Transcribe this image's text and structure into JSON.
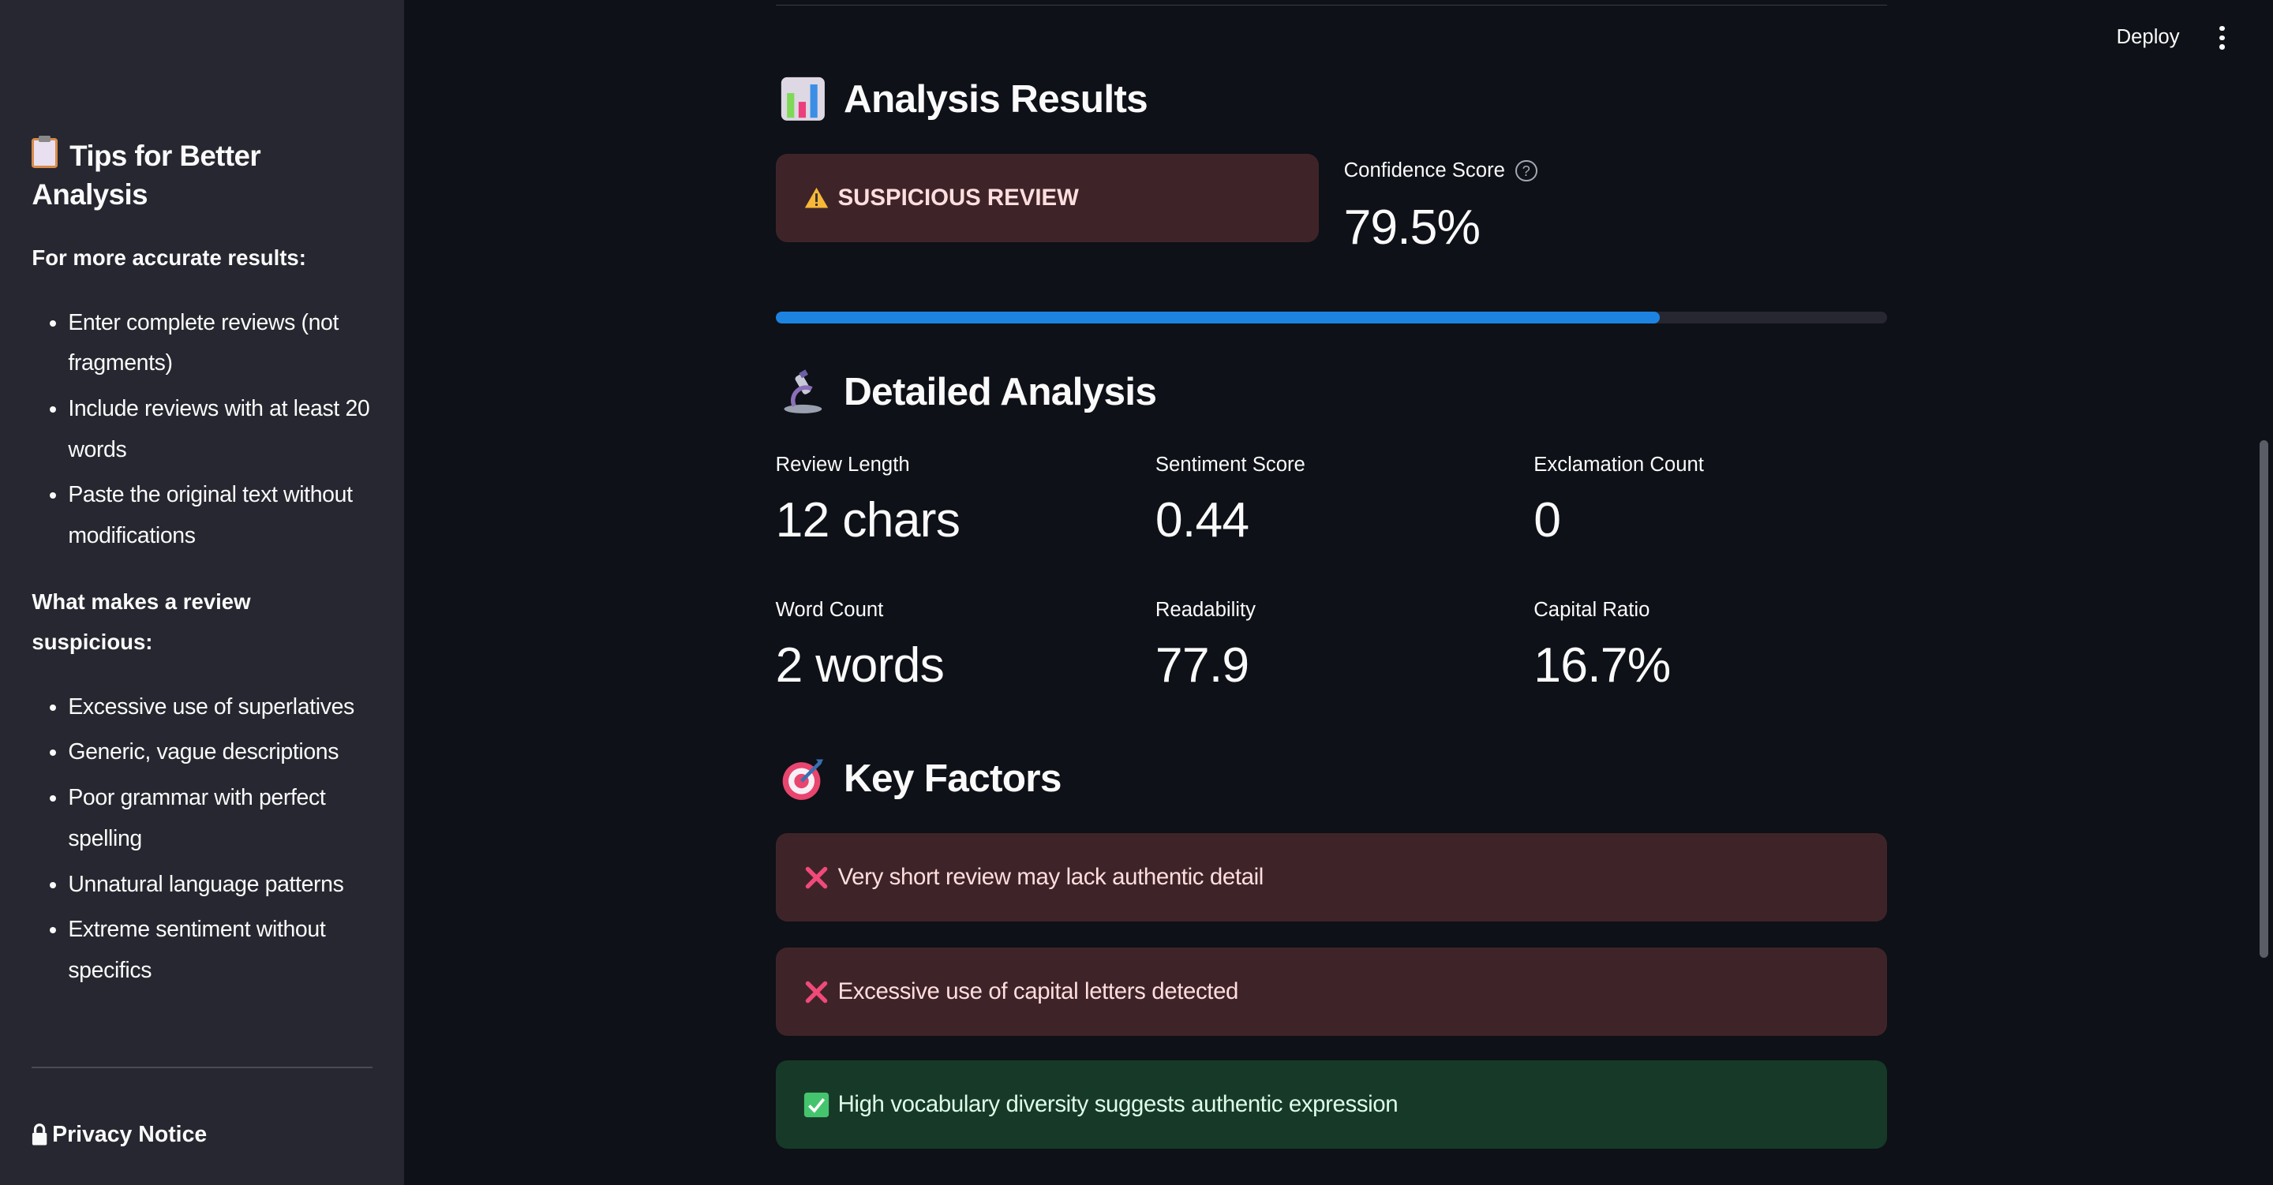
{
  "sidebar": {
    "title": "Tips for Better Analysis",
    "accurate_heading": "For more accurate results:",
    "accurate_tips": [
      "Enter complete reviews (not fragments)",
      "Include reviews with at least 20 words",
      "Paste the original text without modifications"
    ],
    "suspicious_heading": "What makes a review suspicious:",
    "suspicious_signs": [
      "Excessive use of superlatives",
      "Generic, vague descriptions",
      "Poor grammar with perfect spelling",
      "Unnatural language patterns",
      "Extreme sentiment without specifics"
    ],
    "privacy_label": "Privacy Notice"
  },
  "header": {
    "deploy_label": "Deploy"
  },
  "results": {
    "title": "Analysis Results",
    "verdict": "SUSPICIOUS REVIEW",
    "confidence_label": "Confidence Score",
    "confidence_value": "79.5%",
    "confidence_fraction": 0.795
  },
  "detailed": {
    "title": "Detailed Analysis",
    "metrics": [
      {
        "label": "Review Length",
        "value": "12 chars"
      },
      {
        "label": "Sentiment Score",
        "value": "0.44"
      },
      {
        "label": "Exclamation Count",
        "value": "0"
      },
      {
        "label": "Word Count",
        "value": "2 words"
      },
      {
        "label": "Readability",
        "value": "77.9"
      },
      {
        "label": "Capital Ratio",
        "value": "16.7%"
      }
    ]
  },
  "factors": {
    "title": "Key Factors",
    "items": [
      {
        "text": "Very short review may lack authentic detail",
        "type": "negative"
      },
      {
        "text": "Excessive use of capital letters detected",
        "type": "negative"
      },
      {
        "text": "High vocabulary diversity suggests authentic expression",
        "type": "positive"
      }
    ]
  },
  "colors": {
    "accent": "#1c83e1",
    "error_bg": "#3e2428",
    "success_bg": "#173928",
    "sidebar_bg": "#262730",
    "main_bg": "#0e1117"
  }
}
